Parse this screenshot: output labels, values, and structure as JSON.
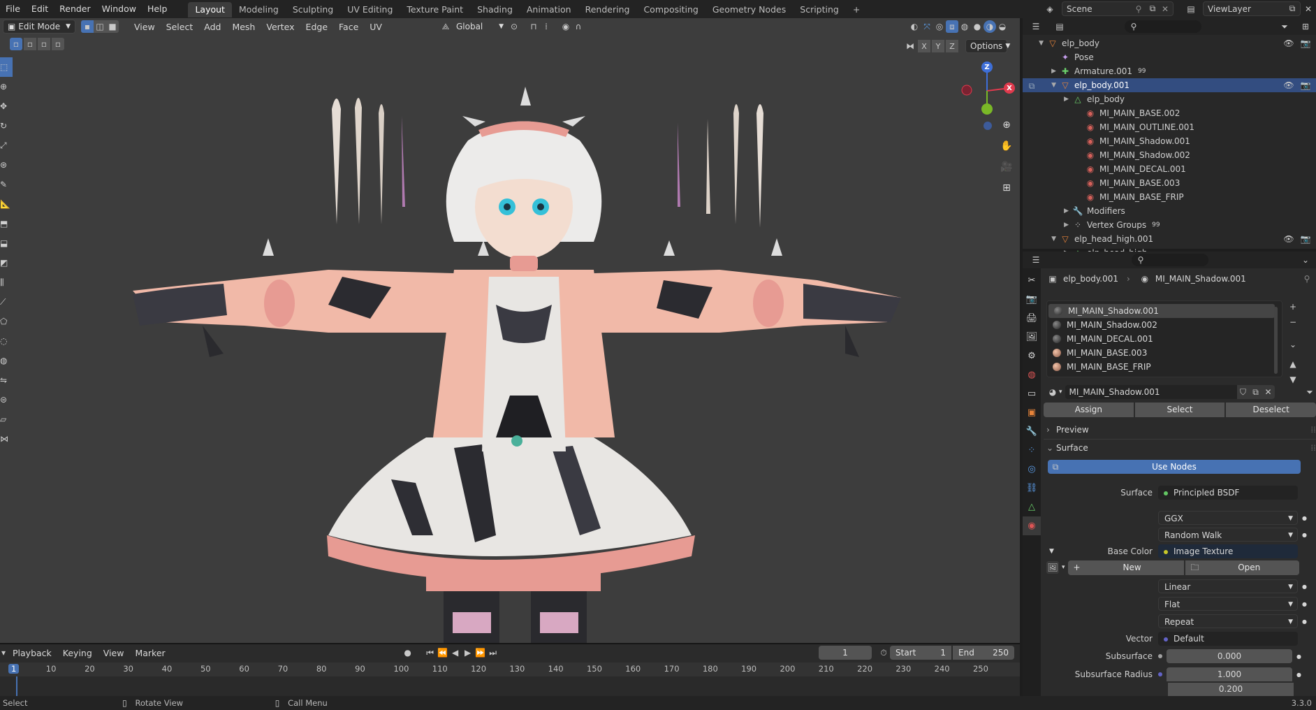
{
  "topbar": {
    "menus": [
      "File",
      "Edit",
      "Render",
      "Window",
      "Help"
    ],
    "workspaces": [
      "Layout",
      "Modeling",
      "Sculpting",
      "UV Editing",
      "Texture Paint",
      "Shading",
      "Animation",
      "Rendering",
      "Compositing",
      "Geometry Nodes",
      "Scripting"
    ],
    "active_workspace": "Layout",
    "add_tab": "+",
    "scene": "Scene",
    "view_layer": "ViewLayer"
  },
  "viewport": {
    "mode": "Edit Mode",
    "menus": [
      "View",
      "Select",
      "Add",
      "Mesh",
      "Vertex",
      "Edge",
      "Face",
      "UV"
    ],
    "orientation": "Global",
    "options_label": "Options",
    "axis_toggles": [
      "X",
      "Y",
      "Z"
    ],
    "gizmo": {
      "z": "Z",
      "y": "Y",
      "x": "X"
    }
  },
  "timeline": {
    "menus": [
      "Playback",
      "Keying",
      "View",
      "Marker"
    ],
    "current_frame": "1",
    "start_label": "Start",
    "start_value": "1",
    "end_label": "End",
    "end_value": "250",
    "ruler": [
      "1",
      "10",
      "20",
      "30",
      "40",
      "50",
      "60",
      "70",
      "80",
      "90",
      "100",
      "110",
      "120",
      "130",
      "140",
      "150",
      "160",
      "170",
      "180",
      "190",
      "200",
      "210",
      "220",
      "230",
      "240",
      "250"
    ]
  },
  "statusbar": {
    "select": "Select",
    "rotate": "Rotate View",
    "menu": "Call Menu",
    "version": "3.3.0"
  },
  "outliner": {
    "rows": [
      {
        "label": "elp_body",
        "indent": 1
      },
      {
        "label": "Pose",
        "indent": 2
      },
      {
        "label": "Armature.001",
        "indent": 2,
        "badge": "99"
      },
      {
        "label": "elp_body.001",
        "indent": 2,
        "selected": true
      },
      {
        "label": "elp_body",
        "indent": 3
      },
      {
        "label": "MI_MAIN_BASE.002",
        "indent": 4
      },
      {
        "label": "MI_MAIN_OUTLINE.001",
        "indent": 4
      },
      {
        "label": "MI_MAIN_Shadow.001",
        "indent": 4
      },
      {
        "label": "MI_MAIN_Shadow.002",
        "indent": 4
      },
      {
        "label": "MI_MAIN_DECAL.001",
        "indent": 4
      },
      {
        "label": "MI_MAIN_BASE.003",
        "indent": 4
      },
      {
        "label": "MI_MAIN_BASE_FRIP",
        "indent": 4
      },
      {
        "label": "Modifiers",
        "indent": 3
      },
      {
        "label": "Vertex Groups",
        "indent": 3,
        "badge": "99"
      },
      {
        "label": "elp_head_high.001",
        "indent": 2
      },
      {
        "label": "elp_head_high",
        "indent": 3
      }
    ]
  },
  "properties": {
    "breadcrumb_object": "elp_body.001",
    "breadcrumb_material": "MI_MAIN_Shadow.001",
    "slots": [
      "MI_MAIN_Shadow.001",
      "MI_MAIN_Shadow.002",
      "MI_MAIN_DECAL.001",
      "MI_MAIN_BASE.003",
      "MI_MAIN_BASE_FRIP"
    ],
    "material_name": "MI_MAIN_Shadow.001",
    "assign": "Assign",
    "select": "Select",
    "deselect": "Deselect",
    "preview": "Preview",
    "surface_section": "Surface",
    "use_nodes": "Use Nodes",
    "surface_label": "Surface",
    "surface_value": "Principled BSDF",
    "distribution": "GGX",
    "subsurface_method": "Random Walk",
    "base_color_label": "Base Color",
    "base_color_value": "Image Texture",
    "new": "New",
    "open": "Open",
    "interpolation": "Linear",
    "projection": "Flat",
    "extension": "Repeat",
    "vector_label": "Vector",
    "vector_value": "Default",
    "subsurface_label": "Subsurface",
    "subsurface_value": "0.000",
    "subsurface_radius_label": "Subsurface Radius",
    "subsurface_radius_value": "1.000",
    "subsurface_radius_value2": "0.200"
  }
}
